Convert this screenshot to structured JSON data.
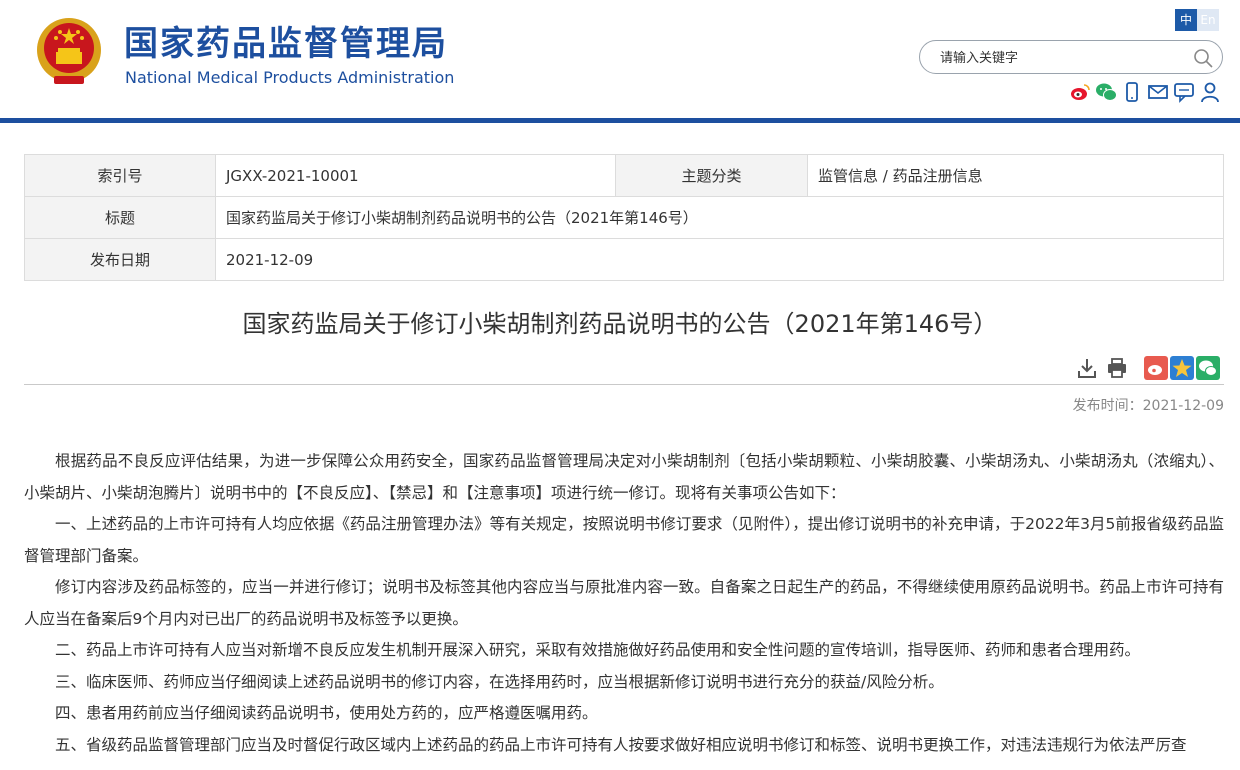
{
  "header": {
    "site_name_cn": "国家药品监督管理局",
    "site_name_en": "National Medical Products Administration",
    "lang_zh": "中",
    "lang_en": "En",
    "search_placeholder": "请输入关键字",
    "search_icon": "search-icon",
    "social_icons": [
      "weibo-icon",
      "wechat-icon",
      "mobile-icon",
      "mail-icon",
      "message-icon",
      "user-icon"
    ],
    "brand_color": "#1d4f9f"
  },
  "info_table": {
    "index_label": "索引号",
    "index_value": "JGXX-2021-10001",
    "category_label": "主题分类",
    "category_value": "监管信息 / 药品注册信息",
    "title_label": "标题",
    "title_value": "国家药监局关于修订小柴胡制剂药品说明书的公告（2021年第146号）",
    "date_label": "发布日期",
    "date_value": "2021-12-09"
  },
  "article": {
    "title": "国家药监局关于修订小柴胡制剂药品说明书的公告（2021年第146号）",
    "publish_time_label": "发布时间：",
    "publish_time": "2021-12-09",
    "tool_icons": [
      "download-icon",
      "print-icon"
    ],
    "share_icons": [
      "weibo-share-icon",
      "qzone-share-icon",
      "wechat-share-icon"
    ],
    "paragraphs": [
      "根据药品不良反应评估结果，为进一步保障公众用药安全，国家药品监督管理局决定对小柴胡制剂〔包括小柴胡颗粒、小柴胡胶囊、小柴胡汤丸、小柴胡汤丸（浓缩丸）、小柴胡片、小柴胡泡腾片〕说明书中的【不良反应】、【禁忌】和【注意事项】项进行统一修订。现将有关事项公告如下：",
      "一、上述药品的上市许可持有人均应依据《药品注册管理办法》等有关规定，按照说明书修订要求（见附件），提出修订说明书的补充申请，于2022年3月5前报省级药品监督管理部门备案。",
      "修订内容涉及药品标签的，应当一并进行修订；说明书及标签其他内容应当与原批准内容一致。自备案之日起生产的药品，不得继续使用原药品说明书。药品上市许可持有人应当在备案后9个月内对已出厂的药品说明书及标签予以更换。",
      "二、药品上市许可持有人应当对新增不良反应发生机制开展深入研究，采取有效措施做好药品使用和安全性问题的宣传培训，指导医师、药师和患者合理用药。",
      "三、临床医师、药师应当仔细阅读上述药品说明书的修订内容，在选择用药时，应当根据新修订说明书进行充分的获益/风险分析。",
      "四、患者用药前应当仔细阅读药品说明书，使用处方药的，应严格遵医嘱用药。",
      "五、省级药品监督管理部门应当及时督促行政区域内上述药品的药品上市许可持有人按要求做好相应说明书修订和标签、说明书更换工作，对违法违规行为依法严厉查"
    ]
  }
}
